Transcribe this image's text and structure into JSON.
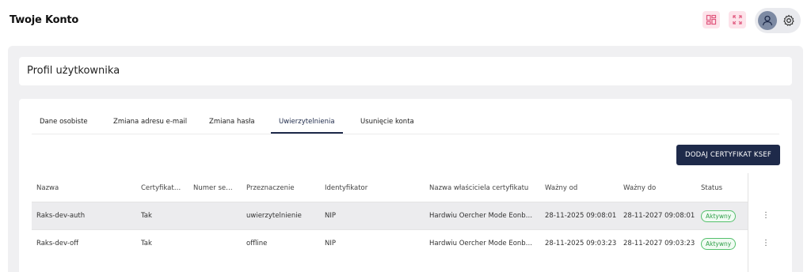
{
  "app": {
    "title": "Twoje Konto"
  },
  "header_icons": [
    {
      "name": "layout-switch-icon"
    },
    {
      "name": "fullscreen-icon"
    }
  ],
  "user": {
    "avatar_icon": "user-icon",
    "settings_icon": "gear-icon"
  },
  "colors": {
    "accent": "#1e2a4a",
    "status_active": "#2e9e48",
    "icon_bg": "#fde3ea",
    "icon_fg": "#e0577d"
  },
  "profile": {
    "title": "Profil użytkownika"
  },
  "tabs": [
    {
      "label": "Dane osobiste"
    },
    {
      "label": "Zmiana adresu e-mail"
    },
    {
      "label": "Zmiana hasła"
    },
    {
      "label": "Uwierzytelnienia",
      "active": true
    },
    {
      "label": "Usunięcie konta"
    }
  ],
  "actions": {
    "add_certificate": "DODAJ CERTYFIKAT KSEF"
  },
  "table": {
    "columns": [
      "Nazwa",
      "Certyfikat…",
      "Numer se…",
      "Przeznaczenie",
      "Identyfikator",
      "Nazwa właściciela certyfikatu",
      "Ważny od",
      "Ważny do",
      "Status"
    ],
    "rows": [
      {
        "cells": [
          "Raks-dev-auth",
          "Tak",
          "",
          "uwierzytelnienie",
          "NIP",
          "Hardwiu Oercher Mode Eonb…",
          "28-11-2025 09:08:01",
          "28-11-2027 09:08:01"
        ],
        "status": "Aktywny"
      },
      {
        "cells": [
          "Raks-dev-off",
          "Tak",
          "",
          "offline",
          "NIP",
          "Hardwiu Oercher Mode Eonb…",
          "28-11-2025 09:03:23",
          "28-11-2027 09:03:23"
        ],
        "status": "Aktywny"
      }
    ]
  }
}
